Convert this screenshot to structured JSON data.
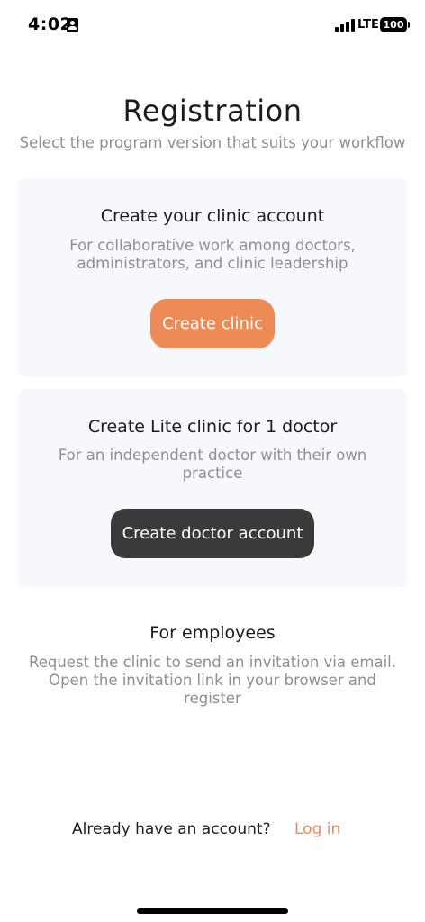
{
  "status_bar": {
    "time": "4:02",
    "network": "LTE",
    "battery": "100",
    "icons": [
      "contact-card-icon",
      "signal-bars-icon",
      "battery-icon"
    ]
  },
  "header": {
    "title": "Registration",
    "subtitle": "Select the program version that suits your workflow"
  },
  "clinic_card": {
    "title": "Create your clinic account",
    "description": "For collaborative work among doctors, administrators, and clinic leadership",
    "button_label": "Create clinic",
    "button_color": "#ee8a56"
  },
  "lite_card": {
    "title": "Create Lite clinic for 1 doctor",
    "description": "For an independent doctor with their own practice",
    "button_label": "Create doctor account",
    "button_color": "#3a3a3a"
  },
  "employees": {
    "title": "For employees",
    "description": "Request the clinic to send an invitation via email. Open the invitation link in your browser and register"
  },
  "login": {
    "prompt": "Already have an account?",
    "link_label": "Log in",
    "link_color": "#ee8a56"
  }
}
